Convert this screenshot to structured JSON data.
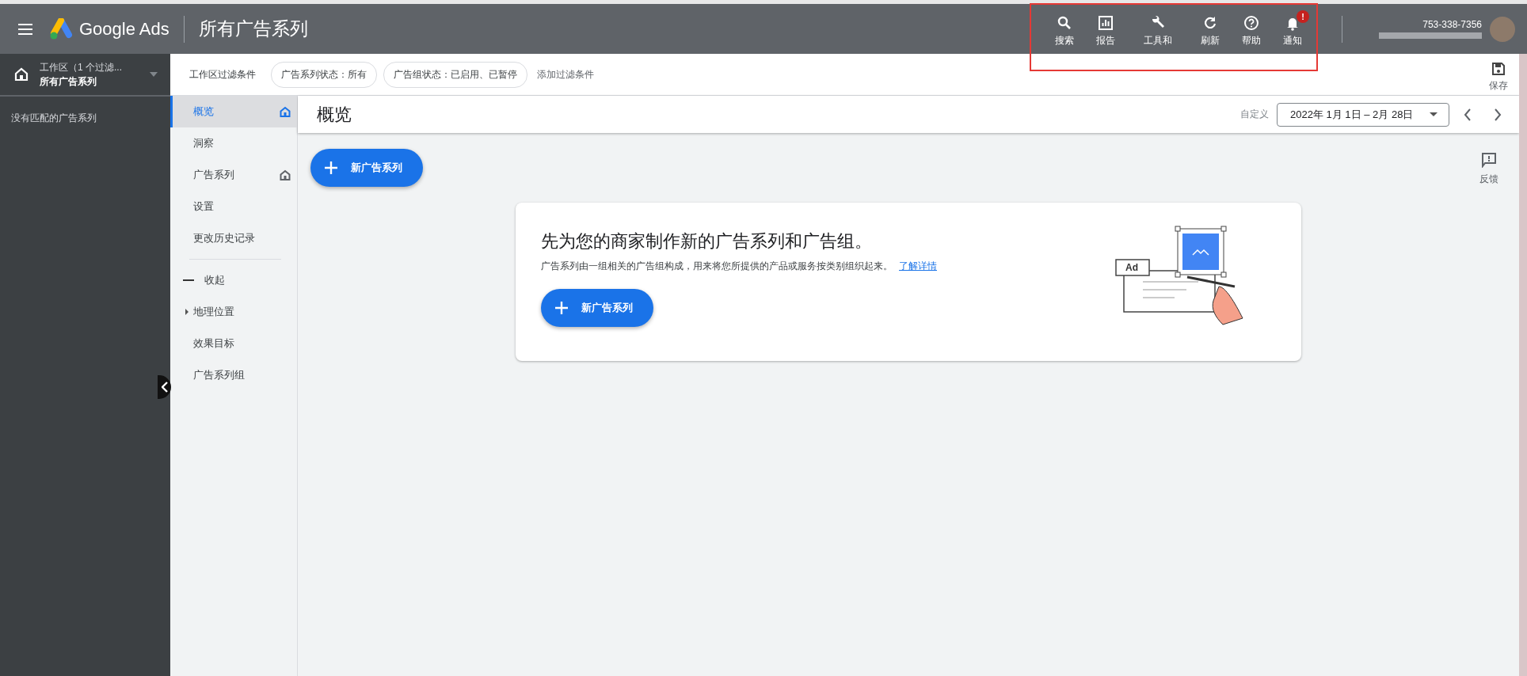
{
  "header": {
    "logo_text": "Google Ads",
    "page_title": "所有广告系列",
    "tools": [
      {
        "kind": "search",
        "label": "搜索"
      },
      {
        "kind": "report",
        "label": "报告"
      },
      {
        "kind": "tools",
        "label": "工具和"
      },
      {
        "kind": "refresh",
        "label": "刷新"
      },
      {
        "kind": "help",
        "label": "帮助"
      },
      {
        "kind": "notify",
        "label": "通知",
        "badge": "!"
      }
    ],
    "account_phone": "753-338-7356"
  },
  "workspace": {
    "title": "工作区（1 个过滤...",
    "subtitle": "所有广告系列",
    "empty_text": "没有匹配的广告系列"
  },
  "filter_bar": {
    "label": "工作区过滤条件",
    "chips": [
      "广告系列状态：所有",
      "广告组状态：已启用、已暂停"
    ],
    "add_filter": "添加过滤条件",
    "save": "保存"
  },
  "nav": [
    {
      "kind": "item",
      "label": "概览",
      "selected": true,
      "home": true
    },
    {
      "kind": "item",
      "label": "洞察",
      "selected": false,
      "home": false
    },
    {
      "kind": "item",
      "label": "广告系列",
      "selected": false,
      "home": true
    },
    {
      "kind": "item",
      "label": "设置",
      "selected": false,
      "home": false
    },
    {
      "kind": "item",
      "label": "更改历史记录",
      "selected": false,
      "home": false
    },
    {
      "kind": "collapse",
      "label": "收起",
      "selected": false,
      "home": false
    },
    {
      "kind": "expandable",
      "label": "地理位置",
      "selected": false,
      "home": false
    },
    {
      "kind": "item",
      "label": "效果目标",
      "selected": false,
      "home": false
    },
    {
      "kind": "item",
      "label": "广告系列组",
      "selected": false,
      "home": false
    }
  ],
  "page": {
    "title": "概览",
    "date_label": "自定义",
    "date_range": "2022年 1月 1日 – 2月 28日",
    "new_button": "新广告系列",
    "feedback": "反馈"
  },
  "card": {
    "title": "先为您的商家制作新的广告系列和广告组。",
    "description": "广告系列由一组相关的广告组构成，用来将您所提供的产品或服务按类别组织起来。",
    "link": "了解详情",
    "button": "新广告系列",
    "illustration_label": "Ad"
  }
}
